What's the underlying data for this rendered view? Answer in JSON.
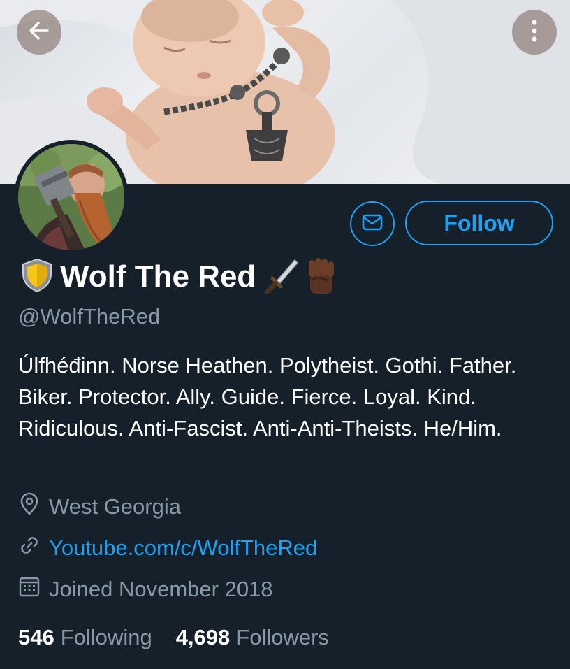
{
  "header": {
    "back_icon": "arrow-left-icon",
    "more_icon": "more-vertical-icon"
  },
  "profile": {
    "display_name": "Wolf The Red",
    "name_emoji": [
      "shield",
      "dagger",
      "raised-fist"
    ],
    "handle": "@WolfTheRed",
    "bio": "Úlfhéđinn. Norse Heathen. Polytheist. Gothi. Father. Biker. Protector. Ally. Guide. Fierce. Loyal. Kind. Ridiculous. Anti-Fascist. Anti-Anti-Theists. He/Him.",
    "location": "West Georgia",
    "website": "Youtube.com/c/WolfTheRed",
    "joined": "Joined November 2018"
  },
  "actions": {
    "follow_label": "Follow",
    "message_icon": "mail-icon"
  },
  "stats": {
    "following_count": "546",
    "following_label": "Following",
    "followers_count": "4,698",
    "followers_label": "Followers"
  },
  "colors": {
    "background": "#15202b",
    "accent": "#1da1f2",
    "secondary_text": "#8899a6"
  }
}
